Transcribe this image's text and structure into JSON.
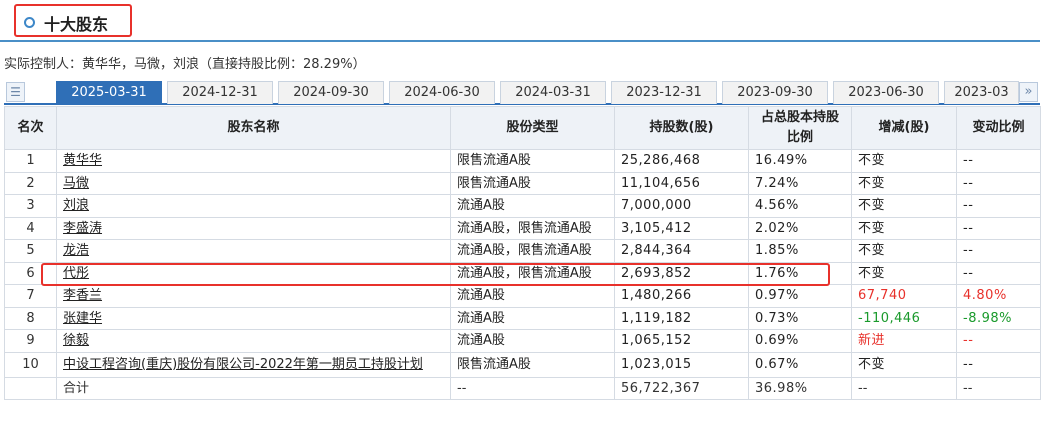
{
  "title": "十大股东",
  "controller_text": "实际控制人：黄华华，马微，刘浪（直接持股比例：28.29%）",
  "tabs": [
    "2025-03-31",
    "2024-12-31",
    "2024-09-30",
    "2024-06-30",
    "2024-03-31",
    "2023-12-31",
    "2023-09-30",
    "2023-06-30",
    "2023-03"
  ],
  "active_tab": 0,
  "icons": {
    "tab_list": "list-icon",
    "tab_scroll": "double-chevron-right-icon"
  },
  "colors": {
    "accent": "#2f6fb7",
    "highlight": "#e8312b",
    "increase": "#e8312b",
    "decrease": "#1a9a2c"
  },
  "table": {
    "headers": [
      "名次",
      "股东名称",
      "股份类型",
      "持股数(股)",
      "占总股本持股比例",
      "增减(股)",
      "变动比例"
    ],
    "rows": [
      {
        "rank": "1",
        "name": "黄华华",
        "type": "限售流通A股",
        "shares": "25,286,468",
        "pct": "16.49%",
        "change": "不变",
        "change_ratio": "--"
      },
      {
        "rank": "2",
        "name": "马微",
        "type": "限售流通A股",
        "shares": "11,104,656",
        "pct": "7.24%",
        "change": "不变",
        "change_ratio": "--"
      },
      {
        "rank": "3",
        "name": "刘浪",
        "type": "流通A股",
        "shares": "7,000,000",
        "pct": "4.56%",
        "change": "不变",
        "change_ratio": "--"
      },
      {
        "rank": "4",
        "name": "李盛涛",
        "type": "流通A股，限售流通A股",
        "shares": "3,105,412",
        "pct": "2.02%",
        "change": "不变",
        "change_ratio": "--"
      },
      {
        "rank": "5",
        "name": "龙浩",
        "type": "流通A股，限售流通A股",
        "shares": "2,844,364",
        "pct": "1.85%",
        "change": "不变",
        "change_ratio": "--"
      },
      {
        "rank": "6",
        "name": "代彤",
        "type": "流通A股，限售流通A股",
        "shares": "2,693,852",
        "pct": "1.76%",
        "change": "不变",
        "change_ratio": "--"
      },
      {
        "rank": "7",
        "name": "李香兰",
        "type": "流通A股",
        "shares": "1,480,266",
        "pct": "0.97%",
        "change": "67,740",
        "change_ratio": "4.80%"
      },
      {
        "rank": "8",
        "name": "张建华",
        "type": "流通A股",
        "shares": "1,119,182",
        "pct": "0.73%",
        "change": "-110,446",
        "change_ratio": "-8.98%"
      },
      {
        "rank": "9",
        "name": "徐毅",
        "type": "流通A股",
        "shares": "1,065,152",
        "pct": "0.69%",
        "change": "新进",
        "change_ratio": "--"
      },
      {
        "rank": "10",
        "name": "中设工程咨询(重庆)股份有限公司-2022年第一期员工持股计划",
        "type": "限售流通A股",
        "shares": "1,023,015",
        "pct": "0.67%",
        "change": "不变",
        "change_ratio": "--"
      }
    ],
    "total": {
      "label": "合计",
      "type": "--",
      "shares": "56,722,367",
      "pct": "36.98%",
      "change": "--",
      "change_ratio": "--"
    }
  }
}
